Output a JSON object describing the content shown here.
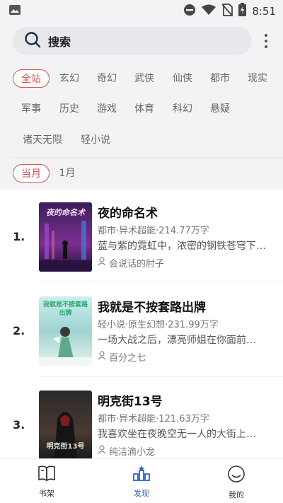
{
  "status_bar": {
    "time": "8:51",
    "icons": [
      "image-icon",
      "dnd-icon",
      "wifi-icon",
      "no-sim-icon",
      "battery-charging-icon"
    ]
  },
  "search": {
    "label": "搜索",
    "icon": "search-icon",
    "more_icon": "more-vertical-icon"
  },
  "categories": {
    "row1": [
      "全站",
      "玄幻",
      "奇幻",
      "武侠",
      "仙侠",
      "都市",
      "现实"
    ],
    "row2": [
      "军事",
      "历史",
      "游戏",
      "体育",
      "科幻",
      "悬疑"
    ],
    "row3": [
      "诸天无限",
      "轻小说"
    ],
    "active": "全站",
    "accent": "#d9534f"
  },
  "period": {
    "items": [
      "当月",
      "1月"
    ],
    "active": "当月"
  },
  "books": [
    {
      "rank": "1.",
      "title": "夜的命名术",
      "meta": "都市·异术超能·214.77万字",
      "desc": "蓝与紫的霓虹中，浓密的钢铁苍穹下…",
      "author": "会说话的肘子",
      "cover_text": "夜的命名术"
    },
    {
      "rank": "2.",
      "title": "我就是不按套路出牌",
      "meta": "轻小说·原生幻想·231.99万字",
      "desc": "一场大战之后，漂亮师姐在你面前…",
      "author": "百分之七",
      "cover_text": "我就是不按套路出牌"
    },
    {
      "rank": "3.",
      "title": "明克街13号",
      "meta": "都市·异术超能·121.63万字",
      "desc": "我喜欢坐在夜晚空无一人的大街上…",
      "author": "纯洁滴小龙",
      "cover_text": "明克街13号"
    }
  ],
  "bottom_nav": [
    {
      "label": "书架",
      "icon": "bookshelf-icon"
    },
    {
      "label": "发现",
      "icon": "discover-icon",
      "active": true
    },
    {
      "label": "我的",
      "icon": "profile-smile-icon"
    }
  ],
  "colors": {
    "accent_red": "#d9534f",
    "nav_active": "#2a62c9"
  }
}
